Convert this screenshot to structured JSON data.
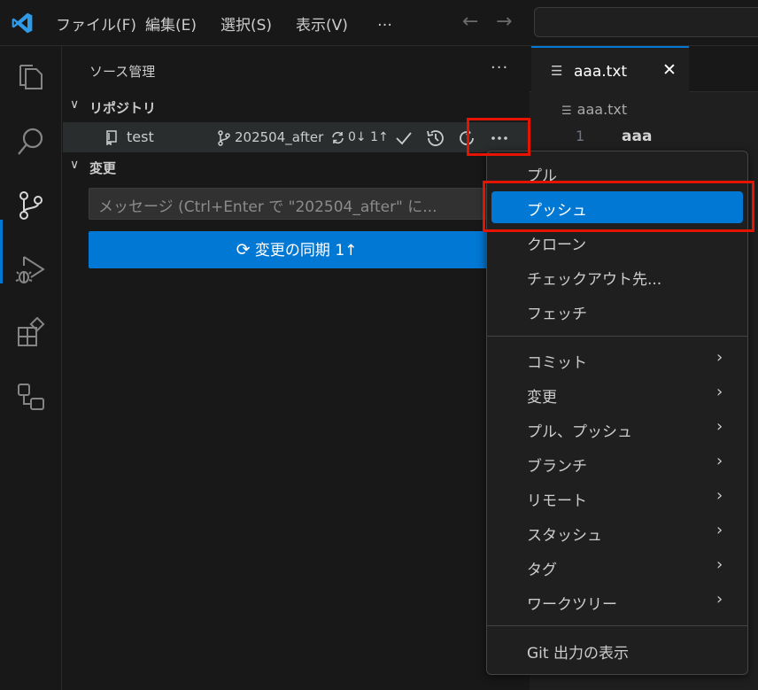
{
  "titlebar": {
    "menus": [
      "ファイル(F)",
      "編集(E)",
      "選択(S)",
      "表示(V)"
    ],
    "overflow": "…",
    "back_arrow": "←",
    "forward_arrow": "→"
  },
  "activitybar": {
    "icons": [
      "explorer-icon",
      "search-icon",
      "source-control-icon",
      "run-debug-icon",
      "extensions-icon",
      "remote-explorer-icon"
    ]
  },
  "sidebar": {
    "title": "ソース管理",
    "more": "···",
    "repositories_section": {
      "chevron": "∨",
      "label": "リポジトリ"
    },
    "repo": {
      "name": "test",
      "branch": "202504_after",
      "sync_status": "0↓ 1↑"
    },
    "changes_section": {
      "chevron": "∨",
      "label": "変更"
    },
    "commit_input": {
      "placeholder": "メッセージ (Ctrl+Enter で \"202504_after\" に..."
    },
    "sync_button": {
      "label": "変更の同期 1↑"
    }
  },
  "editor": {
    "tab": {
      "label": "aaa.txt",
      "close": "✕"
    },
    "breadcrumb": "aaa.txt",
    "lines": [
      {
        "number": "1",
        "text": "aaa"
      }
    ]
  },
  "context_menu": {
    "items": [
      {
        "label": "プル"
      },
      {
        "label": "プッシュ",
        "active": true
      },
      {
        "label": "クローン"
      },
      {
        "label": "チェックアウト先..."
      },
      {
        "label": "フェッチ"
      },
      {
        "label": "コミット",
        "submenu": true
      },
      {
        "label": "変更",
        "submenu": true
      },
      {
        "label": "プル、プッシュ",
        "submenu": true
      },
      {
        "label": "ブランチ",
        "submenu": true
      },
      {
        "label": "リモート",
        "submenu": true
      },
      {
        "label": "スタッシュ",
        "submenu": true
      },
      {
        "label": "タグ",
        "submenu": true
      },
      {
        "label": "ワークツリー",
        "submenu": true
      },
      {
        "label": "Git 出力の表示"
      }
    ],
    "submenu_arrow": "›"
  },
  "colors": {
    "accent": "#0078d4",
    "highlight": "#e51400",
    "background": "#181818",
    "editor_background": "#1f1f1f"
  }
}
